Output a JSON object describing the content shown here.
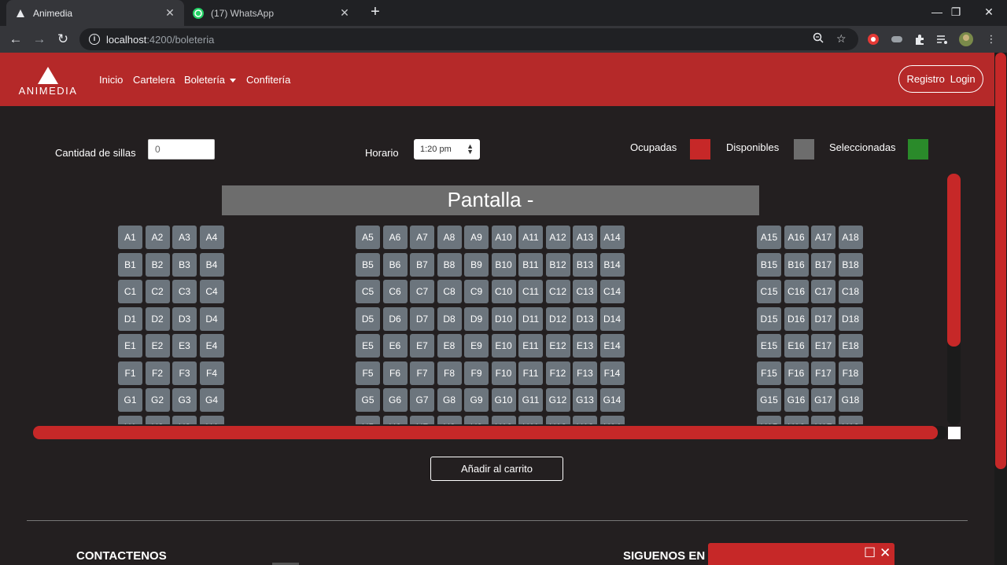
{
  "browser": {
    "tabs": [
      {
        "title": "Animedia",
        "close": "✕"
      },
      {
        "title": "(17) WhatsApp",
        "close": "✕"
      }
    ],
    "new_tab": "+",
    "window_controls": {
      "minimize": "—",
      "restore": "❐",
      "close": "✕"
    },
    "address": {
      "host": "localhost",
      "path": ":4200/boleteria"
    },
    "nav": {
      "back": "←",
      "forward": "→",
      "reload": "↻"
    }
  },
  "header": {
    "logo_text": "ANIMEDIA",
    "nav": [
      "Inicio",
      "Cartelera",
      "Boletería",
      "Confitería"
    ],
    "registro": "Registro",
    "login": "Login"
  },
  "controls": {
    "cantidad_label": "Cantidad de sillas",
    "cantidad_value": "0",
    "horario_label": "Horario",
    "horario_value": "1:20 pm",
    "legend": [
      {
        "label": "Ocupadas",
        "color": "#c62828"
      },
      {
        "label": "Disponibles",
        "color": "#6d6d6d"
      },
      {
        "label": "Seleccionadas",
        "color": "#2a8a2a"
      }
    ]
  },
  "screen_label": "Pantalla -",
  "seat_rows": [
    "A",
    "B",
    "C",
    "D",
    "E",
    "F",
    "G",
    "H"
  ],
  "seat_blocks": [
    [
      1,
      4
    ],
    [
      5,
      14
    ],
    [
      15,
      18
    ]
  ],
  "add_button": "Añadir al carrito",
  "footer": {
    "contact": "CONTACTENOS",
    "follow": "SIGUENOS EN I"
  },
  "popup": {
    "maximize": "☐",
    "close": "✕"
  },
  "colors": {
    "accent": "#b52929",
    "seat": "#6c757d",
    "background": "#231f20"
  }
}
